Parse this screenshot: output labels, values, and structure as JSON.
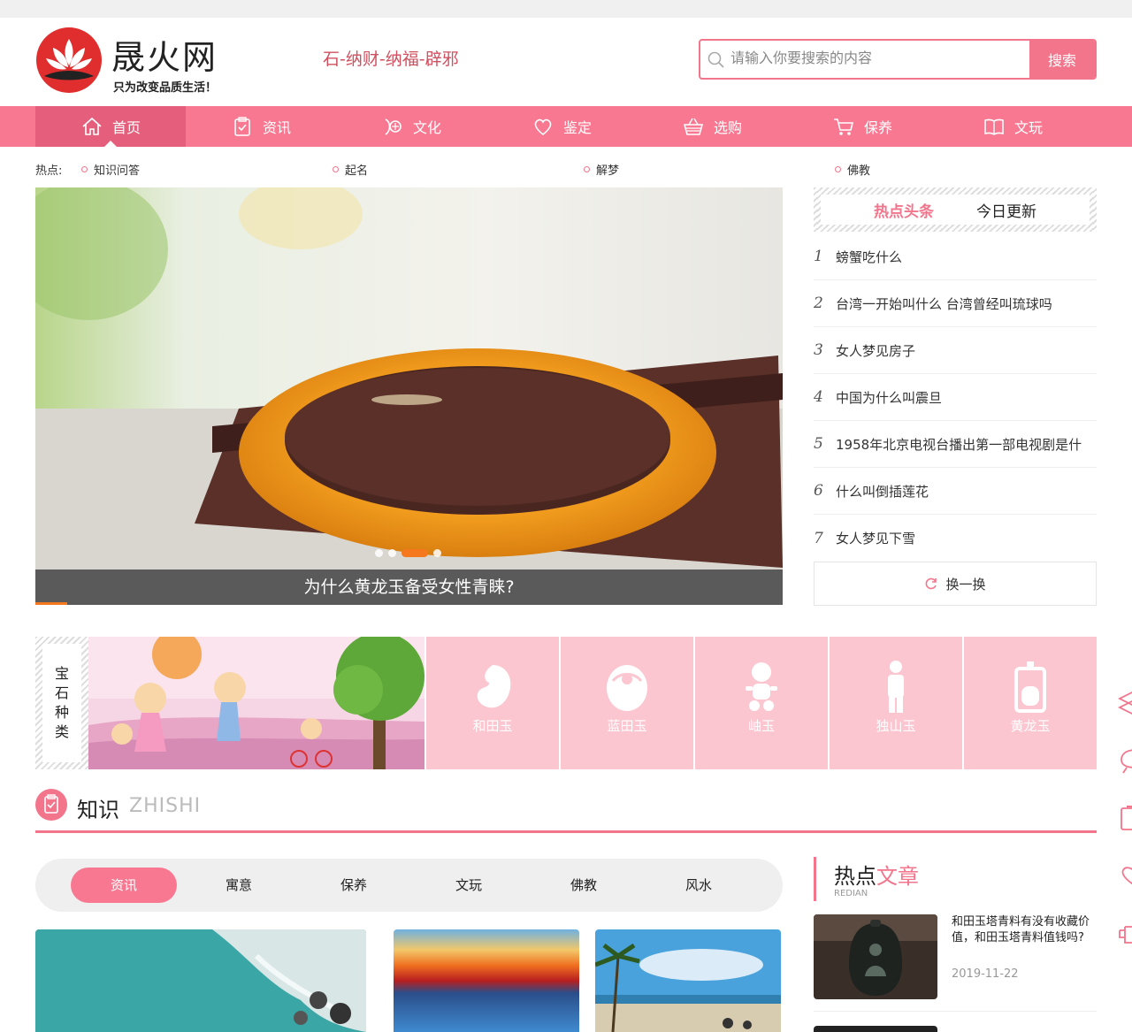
{
  "header": {
    "site_name": "晟火网",
    "slogan": "只为改变品质生活！",
    "tagline": "石-纳财-纳福-辟邪",
    "search_placeholder": "请输入你要搜索的内容",
    "search_button": "搜索"
  },
  "nav": {
    "items": [
      {
        "label": "首页",
        "icon": "home-icon"
      },
      {
        "label": "资讯",
        "icon": "clipboard-icon"
      },
      {
        "label": "文化",
        "icon": "culture-icon"
      },
      {
        "label": "鉴定",
        "icon": "heart-icon"
      },
      {
        "label": "选购",
        "icon": "basket-icon"
      },
      {
        "label": "保养",
        "icon": "cart-icon"
      },
      {
        "label": "文玩",
        "icon": "book-icon"
      }
    ],
    "active_index": 0
  },
  "hot": {
    "label": "热点:",
    "items": [
      "知识问答",
      "起名",
      "解梦",
      "佛教"
    ]
  },
  "banner": {
    "caption": "为什么黄龙玉备受女性青睐?",
    "slide_count": 4,
    "active_slide": 2
  },
  "hot_list": {
    "tabs": [
      "热点头条",
      "今日更新"
    ],
    "active_tab": 0,
    "items": [
      {
        "num": "1",
        "text": "螃蟹吃什么"
      },
      {
        "num": "2",
        "text": "台湾一开始叫什么 台湾曾经叫琉球吗"
      },
      {
        "num": "3",
        "text": "女人梦见房子"
      },
      {
        "num": "4",
        "text": "中国为什么叫震旦"
      },
      {
        "num": "5",
        "text": "1958年北京电视台播出第一部电视剧是什"
      },
      {
        "num": "6",
        "text": "什么叫倒插莲花"
      },
      {
        "num": "7",
        "text": "女人梦见下雪"
      }
    ],
    "refresh_label": "换一换"
  },
  "categories": {
    "label_chars": [
      "宝",
      "石",
      "种",
      "类"
    ],
    "tiles": [
      {
        "label": "和田玉",
        "icon": "fetus-icon"
      },
      {
        "label": "蓝田玉",
        "icon": "baby-icon"
      },
      {
        "label": "岫玉",
        "icon": "toddler-icon"
      },
      {
        "label": "独山玉",
        "icon": "person-icon"
      },
      {
        "label": "黄龙玉",
        "icon": "iv-bag-icon"
      }
    ]
  },
  "knowledge": {
    "title": "知识",
    "title_en": "ZHISHI",
    "tabs": [
      "资讯",
      "寓意",
      "保养",
      "文玩",
      "佛教",
      "风水"
    ],
    "active_tab": 0
  },
  "hot_articles": {
    "title_a": "热点",
    "title_b": "文章",
    "title_en": "REDIAN",
    "items": [
      {
        "text": "和田玉塔青料有没有收藏价值，和田玉塔青料值钱吗?",
        "date": "2019-11-22"
      }
    ]
  },
  "colors": {
    "accent": "#f87891",
    "accent_dark": "#e55f7c",
    "tile_pink": "#fbc6d0",
    "banner_dot_active": "#f5781e"
  }
}
